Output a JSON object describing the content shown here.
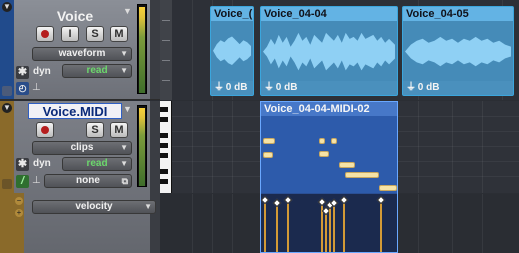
{
  "tracks": [
    {
      "name": "Voice",
      "buttons": {
        "solo": "S",
        "mute": "M",
        "input": "I"
      },
      "view_dropdown": "waveform",
      "dyn_label": "dyn",
      "automation_dropdown": "read",
      "side_icon": "audio-track-icon"
    },
    {
      "name": "Voice.MIDI",
      "buttons": {
        "solo": "S",
        "mute": "M"
      },
      "view_dropdown": "clips",
      "dyn_label": "dyn",
      "automation_dropdown": "read",
      "instrument_dropdown": "none",
      "lane_dropdown": "velocity",
      "side_icon": "midi-track-icon"
    }
  ],
  "audio_clips": [
    {
      "name": "Voice_(",
      "gain": "0 dB"
    },
    {
      "name": "Voice_04-04",
      "gain": "0 dB"
    },
    {
      "name": "Voice_04-05",
      "gain": "0 dB"
    }
  ],
  "midi_clip": {
    "name": "Voice_04-04-MIDI-02"
  },
  "colors": {
    "audio_clip": "#4a9bcc",
    "midi_clip": "#2d5bab",
    "note": "#f6e3a6",
    "velocity_stem": "#d39a36",
    "audio_track": "#214b8c",
    "midi_track": "#8a6a2a"
  }
}
